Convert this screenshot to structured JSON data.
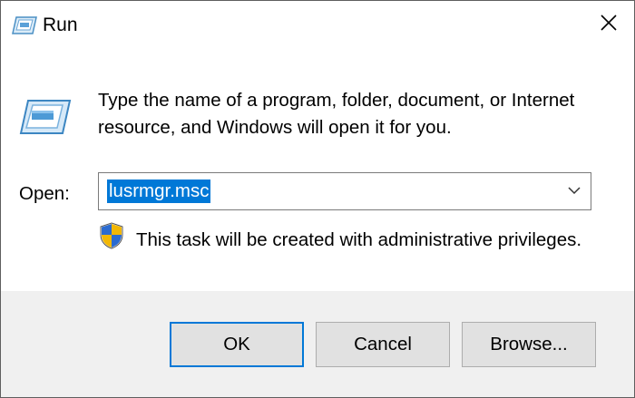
{
  "window": {
    "title": "Run",
    "icon": "run-icon"
  },
  "titlebar": {
    "close_icon": "close-icon"
  },
  "dialog": {
    "description": "Type the name of a program, folder, document, or Internet resource, and Windows will open it for you.",
    "open_label": "Open:",
    "open_value": "lusrmgr.msc",
    "admin_notice": "This task will be created with administrative privileges.",
    "shield_icon": "uac-shield-icon"
  },
  "buttons": {
    "ok": "OK",
    "cancel": "Cancel",
    "browse": "Browse..."
  },
  "colors": {
    "selection": "#0078d7",
    "footer_bg": "#f0f0f0",
    "button_bg": "#e1e1e1",
    "default_button_border": "#0078d7"
  }
}
